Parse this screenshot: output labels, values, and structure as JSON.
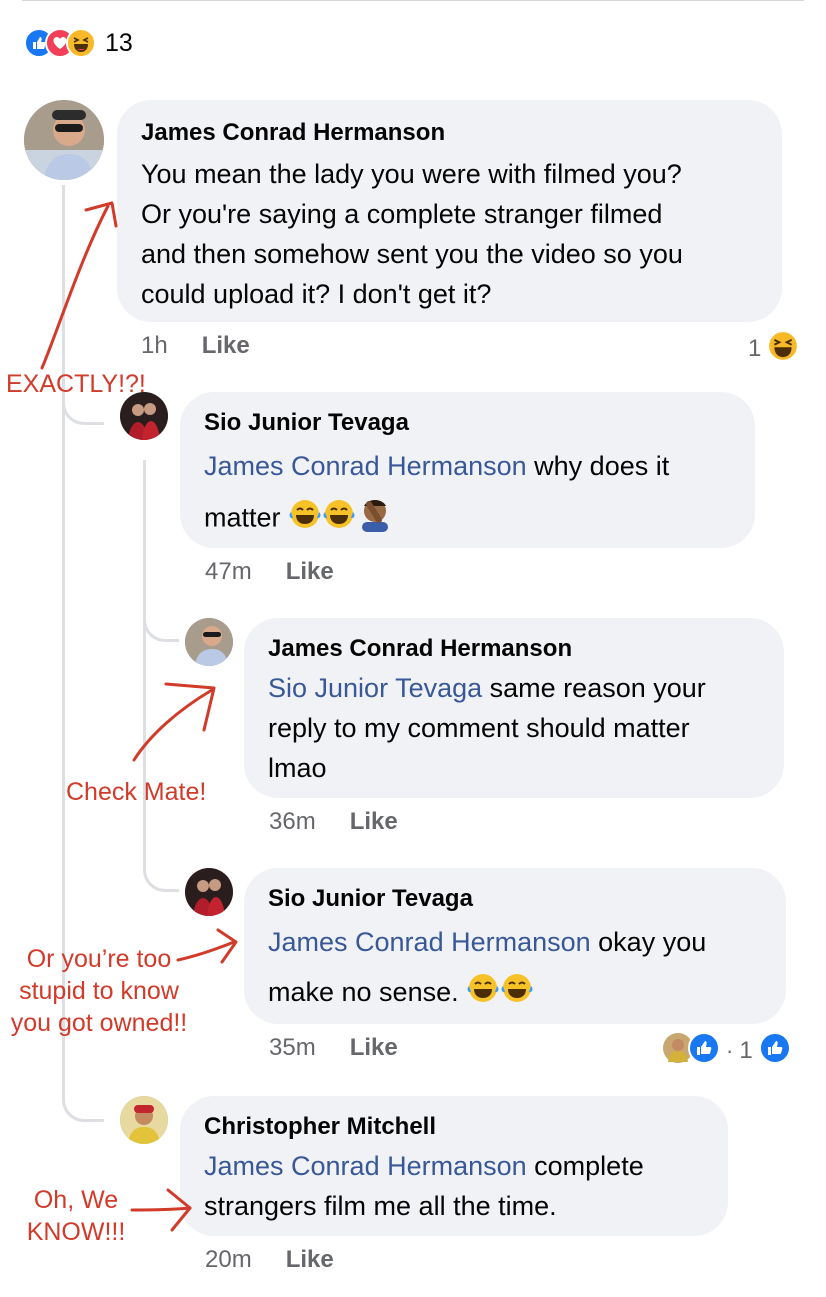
{
  "reactions": {
    "count": "13",
    "icons": [
      "like-icon",
      "love-icon",
      "haha-icon"
    ]
  },
  "comments": [
    {
      "author": "James Conrad Hermanson",
      "text": "You mean the lady you were with filmed you? Or you're saying a complete stranger filmed and then somehow sent you the video so you could upload it? I don't get it?",
      "lines": [
        "You mean the lady you were with filmed you?",
        "Or you're saying a complete stranger filmed",
        "and then somehow sent you the video so you",
        "could upload it? I don't get it?"
      ],
      "time": "1h",
      "like_label": "Like",
      "reaction_count": "1"
    },
    {
      "author": "Sio Junior Tevaga",
      "mention": "James Conrad Hermanson",
      "line1_rest": " why does it",
      "line2": "matter",
      "time": "47m",
      "like_label": "Like"
    },
    {
      "author": "James Conrad Hermanson",
      "mention": "Sio Junior Tevaga",
      "line1_rest": " same reason your",
      "lines": [
        "reply to my comment should matter",
        "lmao"
      ],
      "time": "36m",
      "like_label": "Like"
    },
    {
      "author": "Sio Junior Tevaga",
      "mention": "James Conrad Hermanson",
      "line1_rest": " okay you",
      "line2": "make no sense.",
      "time": "35m",
      "like_label": "Like",
      "reaction_count": "1"
    },
    {
      "author": "Christopher Mitchell",
      "mention": "James Conrad Hermanson",
      "line1_rest": " complete",
      "line2": "strangers film me all the time.",
      "time": "20m",
      "like_label": "Like"
    }
  ],
  "annotations": {
    "exactly": "EXACTLY!?!",
    "checkmate": "Check Mate!",
    "too_stupid": [
      "Or you’re too",
      "stupid to know",
      "you got owned!!"
    ],
    "we_know": [
      "Oh, We",
      "KNOW!!!"
    ]
  },
  "colors": {
    "mention": "#385898",
    "bubble": "#f0f2f5",
    "annotation": "#d23a2a",
    "like_blue": "#1877f2"
  }
}
